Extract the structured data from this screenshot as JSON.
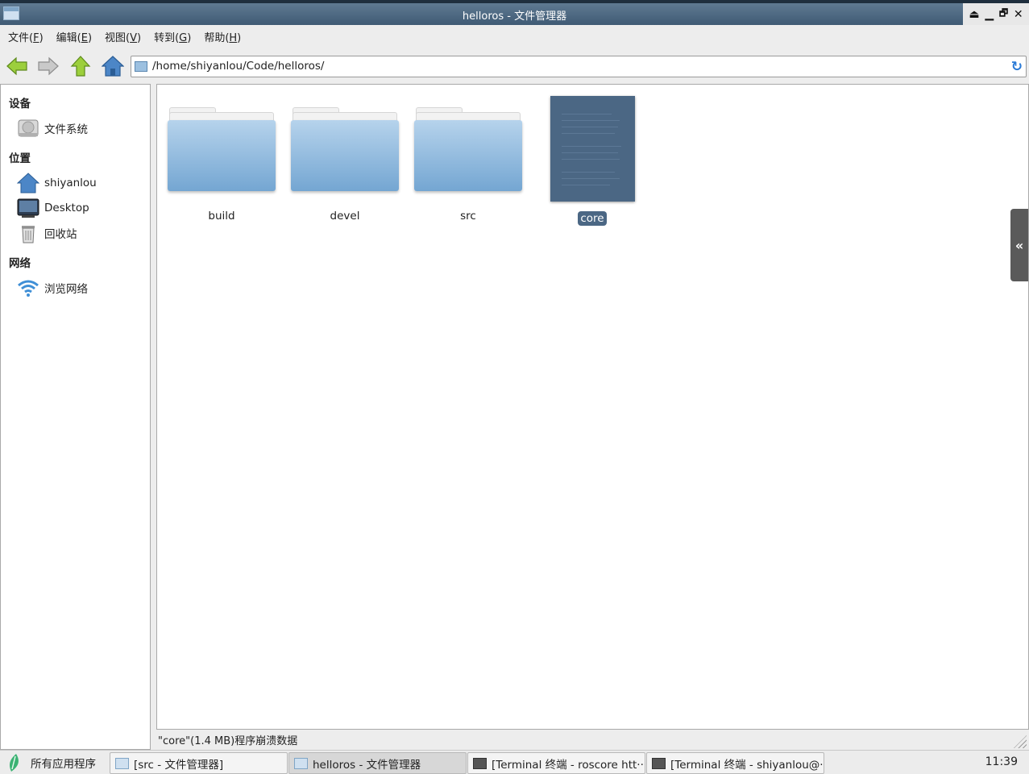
{
  "window": {
    "title": "helloros - 文件管理器",
    "controls": [
      "⏏",
      "▁",
      "🗗",
      "✕"
    ]
  },
  "menu": [
    {
      "label": "文件(",
      "key": "F",
      "end": ")"
    },
    {
      "label": "编辑(",
      "key": "E",
      "end": ")"
    },
    {
      "label": "视图(",
      "key": "V",
      "end": ")"
    },
    {
      "label": "转到(",
      "key": "G",
      "end": ")"
    },
    {
      "label": "帮助(",
      "key": "H",
      "end": ")"
    }
  ],
  "toolbar": {
    "icons": [
      "back-arrow-icon",
      "forward-arrow-icon",
      "up-arrow-icon",
      "home-icon"
    ],
    "path": "/home/shiyanlou/Code/helloros/",
    "reload_icon": "reload-icon"
  },
  "sidebar": {
    "sections": [
      {
        "title": "设备",
        "items": [
          {
            "label": "文件系统",
            "icon": "drive-icon"
          }
        ]
      },
      {
        "title": "位置",
        "items": [
          {
            "label": "shiyanlou",
            "icon": "home-icon"
          },
          {
            "label": "Desktop",
            "icon": "desktop-icon"
          },
          {
            "label": "回收站",
            "icon": "trash-icon"
          }
        ]
      },
      {
        "title": "网络",
        "items": [
          {
            "label": "浏览网络",
            "icon": "wifi-icon"
          }
        ]
      }
    ]
  },
  "files": [
    {
      "name": "build",
      "type": "folder"
    },
    {
      "name": "devel",
      "type": "folder"
    },
    {
      "name": "src",
      "type": "folder"
    },
    {
      "name": "core",
      "type": "file",
      "selected": true
    }
  ],
  "collapse_label": "«",
  "status": "\"core\"(1.4 MB)程序崩溃数据",
  "taskbar": {
    "start_label": "所有应用程序",
    "tasks": [
      {
        "label": "[src - 文件管理器]",
        "icon": "folder-icon",
        "active": false
      },
      {
        "label": "helloros - 文件管理器",
        "icon": "folder-icon",
        "active": true
      },
      {
        "label": "[Terminal 终端 - roscore htt···",
        "icon": "terminal-icon",
        "active": false
      },
      {
        "label": "[Terminal 终端 - shiyanlou@···",
        "icon": "terminal-icon",
        "active": false
      }
    ],
    "clock": "11:39"
  },
  "colors": {
    "title_bar": "#4b6784",
    "selection": "#4b6784",
    "folder": "#8fb8de"
  }
}
